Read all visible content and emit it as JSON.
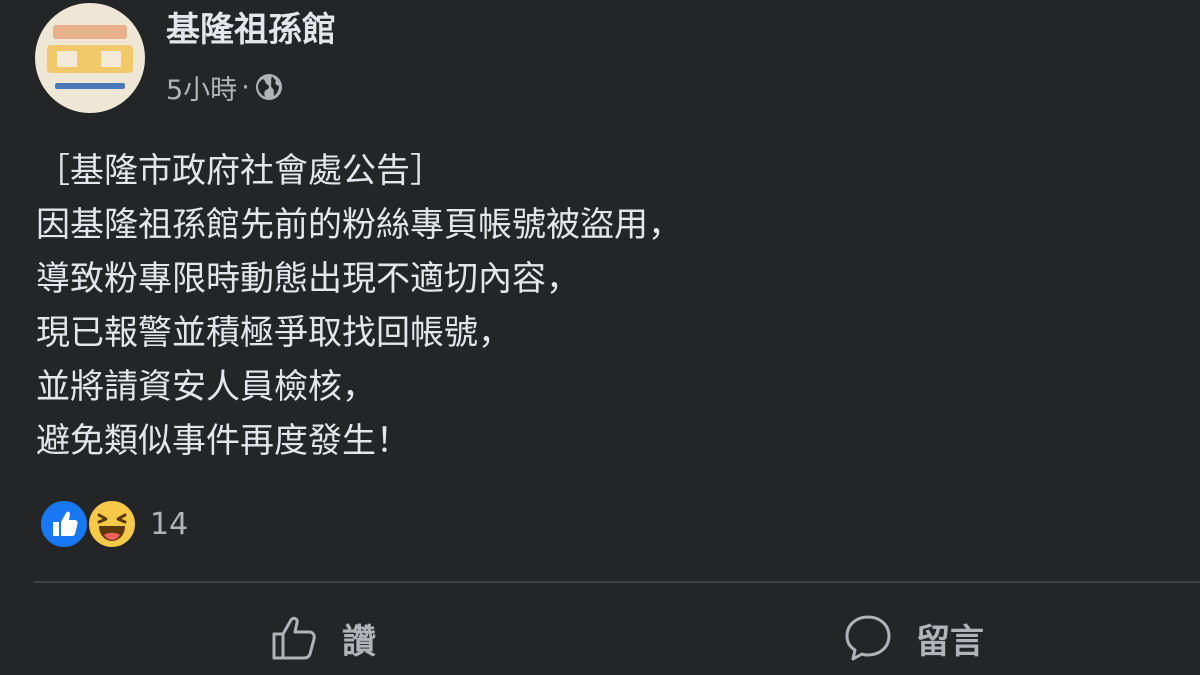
{
  "page": {
    "name": "基隆祖孫館",
    "time": "5小時",
    "separator": "·",
    "privacy_icon": "globe-icon"
  },
  "post": {
    "lines": [
      "［基隆市政府社會處公告］",
      "因基隆祖孫館先前的粉絲專頁帳號被盜用，",
      "導致粉專限時動態出現不適切內容，",
      "現已報警並積極爭取找回帳號，",
      "並將請資安人員檢核，",
      "避免類似事件再度發生！"
    ]
  },
  "reactions": {
    "icons": [
      "like-reaction-icon",
      "haha-reaction-icon"
    ],
    "count": "14"
  },
  "actions": {
    "like_label": "讚",
    "comment_label": "留言"
  },
  "colors": {
    "background": "#242526",
    "text_primary": "#e4e6eb",
    "text_secondary": "#b0b3b8",
    "like_blue": "#1877f2",
    "haha_yellow": "#f7c948"
  }
}
